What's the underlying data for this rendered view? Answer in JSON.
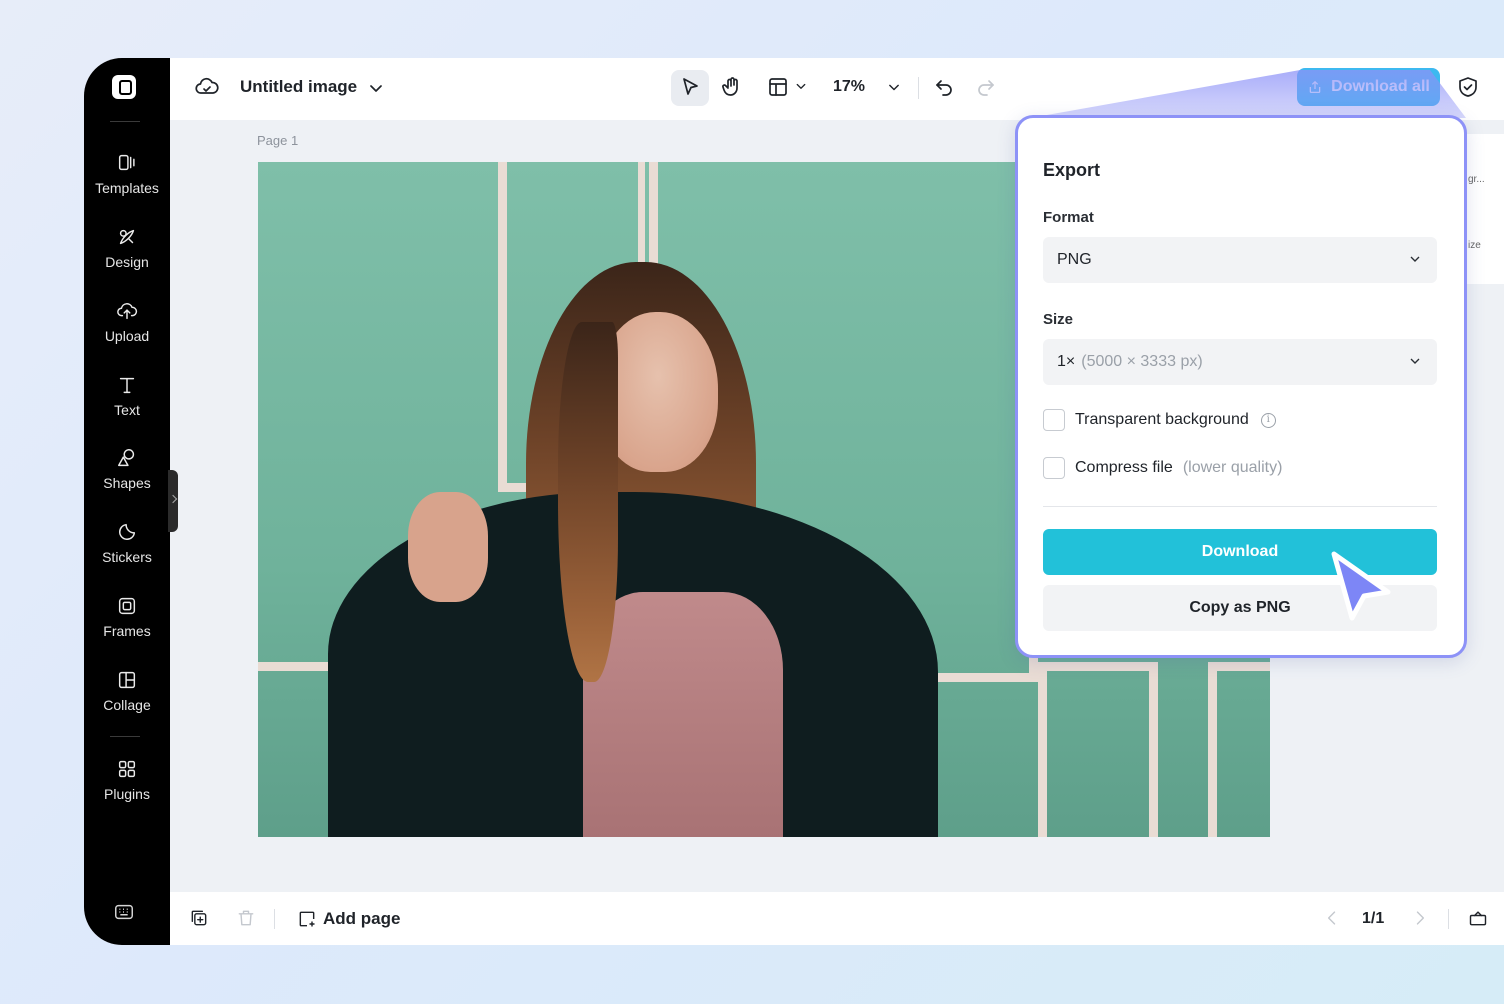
{
  "app": {
    "doc_title": "Untitled image",
    "zoom": "17%",
    "download_all_label": "Download all",
    "page_label": "Page 1"
  },
  "sidebar": {
    "items": [
      {
        "label": "Templates",
        "icon": "templates-icon"
      },
      {
        "label": "Design",
        "icon": "design-icon"
      },
      {
        "label": "Upload",
        "icon": "upload-icon"
      },
      {
        "label": "Text",
        "icon": "text-icon"
      },
      {
        "label": "Shapes",
        "icon": "shapes-icon"
      },
      {
        "label": "Stickers",
        "icon": "stickers-icon"
      },
      {
        "label": "Frames",
        "icon": "frames-icon"
      },
      {
        "label": "Collage",
        "icon": "collage-icon"
      },
      {
        "label": "Plugins",
        "icon": "plugins-icon"
      }
    ]
  },
  "right_strip": {
    "item1": "gr...",
    "item2": "ize"
  },
  "export": {
    "title": "Export",
    "format_label": "Format",
    "format_value": "PNG",
    "size_label": "Size",
    "size_value": "1×",
    "size_detail": "(5000 × 3333 px)",
    "transparent_label": "Transparent background",
    "compress_label": "Compress file",
    "compress_note": "(lower quality)",
    "download_label": "Download",
    "copy_label": "Copy as PNG"
  },
  "bottom": {
    "add_page_label": "Add page",
    "pager": "1/1"
  },
  "colors": {
    "accent": "#3db9f0",
    "download_button": "#22c1d9",
    "popup_border": "#8d92f7",
    "cursor": "#7d86f6"
  }
}
